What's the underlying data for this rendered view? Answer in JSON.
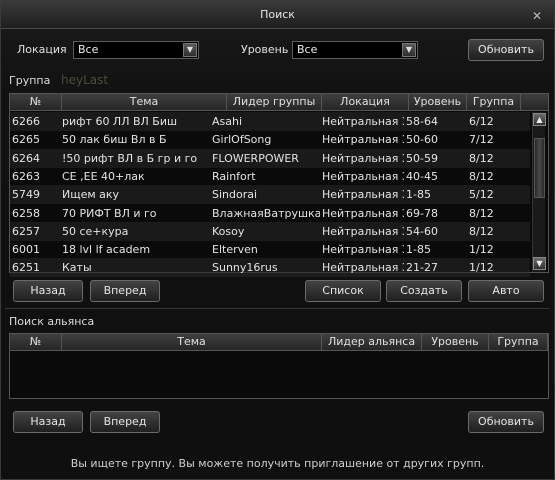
{
  "window": {
    "title": "Поиск"
  },
  "filters": {
    "location_label": "Локация",
    "location_value": "Все",
    "level_label": "Уровень",
    "level_value": "Все",
    "refresh_label": "Обновить"
  },
  "group": {
    "section_label": "Группа",
    "ghost_text": "heyLast",
    "columns": [
      "№",
      "Тема",
      "Лидер группы",
      "Локация",
      "Уровень",
      "Группа"
    ],
    "rows": [
      [
        "6266",
        "рифт 60 ЛЛ ВЛ Биш",
        "Asahi",
        "Нейтральная Зо",
        "58-64",
        "6/12"
      ],
      [
        "6265",
        "50 лак биш Вл в Б",
        "GirlOfSong",
        "Нейтральная Зо",
        "50-60",
        "7/12"
      ],
      [
        "6264",
        "!50 рифт ВЛ в Б гр и го",
        "FLOWERPOWER",
        "Нейтральная Зо",
        "50-59",
        "8/12"
      ],
      [
        "6263",
        "СЕ ,ЕЕ 40+лак",
        "Rainfort",
        "Нейтральная Зо",
        "40-45",
        "8/12"
      ],
      [
        "5749",
        "Ищем аку",
        "Sindorai",
        "Нейтральная Зо",
        "1-85",
        "5/12"
      ],
      [
        "6258",
        "70 РИФТ ВЛ и го",
        "ВлажнаяВатрушка",
        "Нейтральная Зо",
        "69-78",
        "8/12"
      ],
      [
        "6257",
        "50 се+кура",
        "Kosoy",
        "Нейтральная Зо",
        "54-60",
        "8/12"
      ],
      [
        "6001",
        "18 lvl lf academ",
        "Elterven",
        "Нейтральная Зо",
        "1-85",
        "1/12"
      ],
      [
        "6251",
        "Каты",
        "Sunny16rus",
        "Нейтральная Зо",
        "21-27",
        "1/12"
      ]
    ],
    "buttons": {
      "back": "Назад",
      "forward": "Вперед",
      "list": "Список",
      "create": "Создать",
      "auto": "Авто"
    }
  },
  "alliance": {
    "section_label": "Поиск альянса",
    "columns": [
      "№",
      "Тема",
      "Лидер альянса",
      "Уровень",
      "Группа"
    ],
    "buttons": {
      "back": "Назад",
      "forward": "Вперед",
      "refresh": "Обновить"
    }
  },
  "status_text": "Вы ищете группу. Вы можете получить приглашение от других групп."
}
